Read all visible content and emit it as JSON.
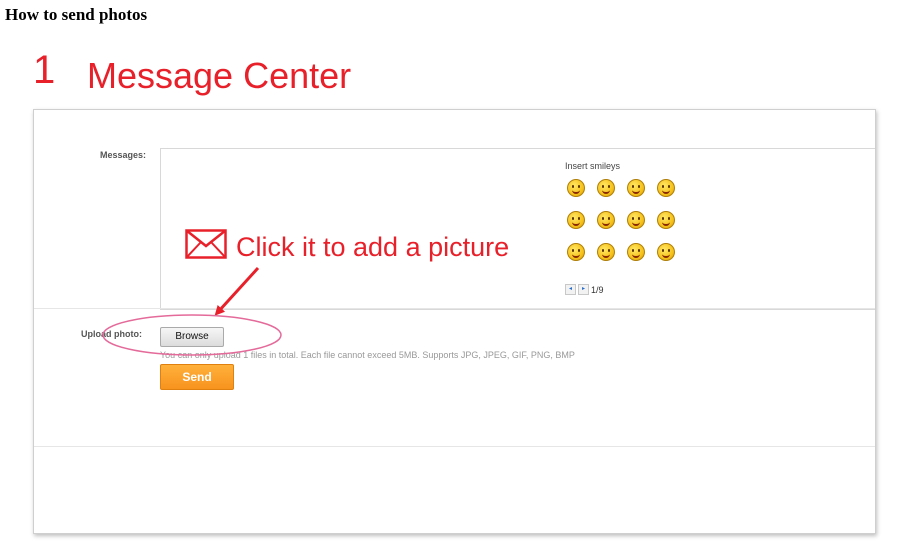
{
  "heading": "How to send photos",
  "step": {
    "number": "1",
    "title": "Message Center"
  },
  "form": {
    "messages_label": "Messages:",
    "smileys_title": "Insert smileys",
    "smileys": [
      "smile-icon",
      "laugh-icon",
      "wink-icon",
      "blush-icon",
      "tongue-icon",
      "shout-icon",
      "grin-icon",
      "cheeky-icon",
      "cry-icon",
      "sleepy-icon",
      "smirk-icon",
      "yum-icon"
    ],
    "pager": {
      "page": "1/9"
    },
    "upload_label": "Upload photo:",
    "browse_label": "Browse",
    "upload_hint": "You can only upload 1 files in total. Each file cannot exceed 5MB. Supports JPG, JPEG, GIF, PNG, BMP",
    "send_label": "Send"
  },
  "annotation": {
    "text": "Click it to add a picture"
  },
  "colors": {
    "accent_red": "#e8202a",
    "send_orange": "#f7931e",
    "highlight_pink": "#e46a9a"
  }
}
